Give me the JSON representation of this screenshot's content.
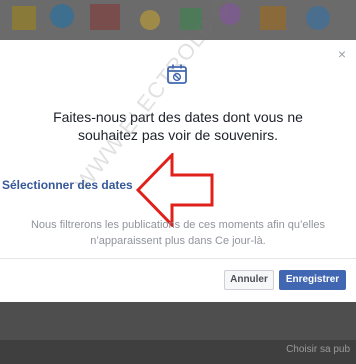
{
  "dialog": {
    "message": "Faites-nous part des dates dont vous ne souhaitez pas voir de souvenirs.",
    "select_dates_label": "Sélectionner des dates",
    "info_text": "Nous filtrerons les publications de ces moments afin qu’elles n’apparaissent plus dans Ce jour-là.",
    "cancel_label": "Annuler",
    "save_label": "Enregistrer",
    "close_symbol": "×",
    "icon": "calendar-icon"
  },
  "background": {
    "footer_link": "Choisir sa pub"
  },
  "watermark": {
    "text": "WWW.ELECTROLD.COM"
  },
  "annotation": {
    "arrow_color": "#e0201b"
  },
  "colors": {
    "link": "#365899",
    "primary_button": "#4267b2"
  }
}
